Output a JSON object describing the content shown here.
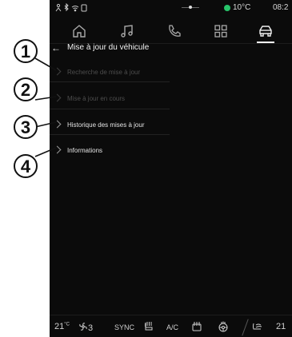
{
  "status_bar": {
    "icons": [
      "person-icon",
      "bluetooth-icon",
      "wifi-icon",
      "phone-icon"
    ],
    "temperature": "10°C",
    "time": "08:2",
    "temp_dot_color": "#27c46a"
  },
  "nav": {
    "items": [
      "home-icon",
      "music-icon",
      "phone-icon",
      "apps-icon",
      "car-icon"
    ],
    "active": "car-icon"
  },
  "page": {
    "title": "Mise à jour du véhicule"
  },
  "menu": {
    "items": [
      {
        "label": "Recherche de mise à jour",
        "state": "disabled"
      },
      {
        "label": "Mise à jour en cours",
        "state": "disabled"
      },
      {
        "label": "Historique des mises à jour",
        "state": "enabled"
      },
      {
        "label": "Informations",
        "state": "enabled"
      }
    ]
  },
  "callouts": [
    "1",
    "2",
    "3",
    "4"
  ],
  "climate": {
    "left_temp": "21",
    "left_unit": "°C",
    "fan_level": "3",
    "sync": "SYNC",
    "ac": "A/C",
    "right_temp": "21"
  }
}
